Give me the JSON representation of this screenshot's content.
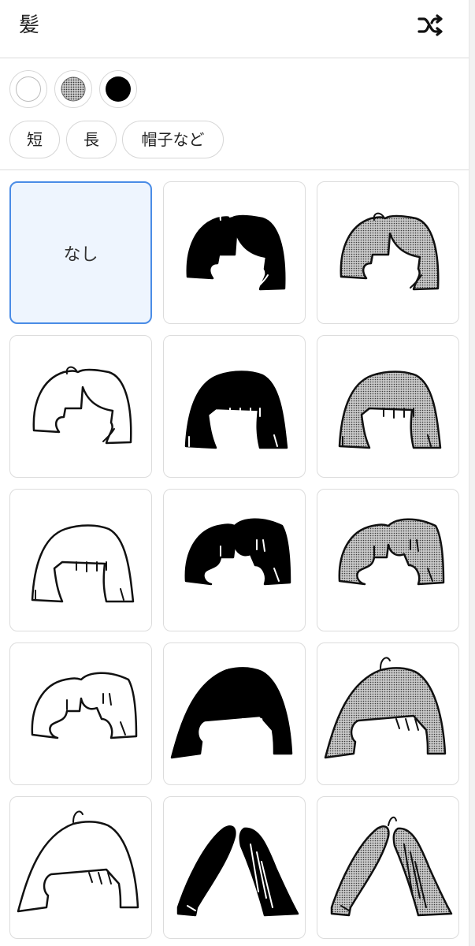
{
  "header": {
    "title": "髪",
    "shuffle_icon": "shuffle-icon"
  },
  "colors": [
    {
      "name": "white",
      "fill": "#ffffff"
    },
    {
      "name": "gray-screentone",
      "fill": "#8a8a8a"
    },
    {
      "name": "black",
      "fill": "#000000"
    }
  ],
  "categories": [
    {
      "label": "短"
    },
    {
      "label": "長"
    },
    {
      "label": "帽子など"
    }
  ],
  "grid": {
    "none_label": "なし",
    "selected_index": 0,
    "items": [
      {
        "kind": "none"
      },
      {
        "kind": "short-parted",
        "tone": "black"
      },
      {
        "kind": "short-parted",
        "tone": "gray"
      },
      {
        "kind": "short-parted",
        "tone": "white"
      },
      {
        "kind": "bob-bangs",
        "tone": "black"
      },
      {
        "kind": "bob-bangs",
        "tone": "gray"
      },
      {
        "kind": "bob-bangs",
        "tone": "white"
      },
      {
        "kind": "fluffy",
        "tone": "black"
      },
      {
        "kind": "fluffy",
        "tone": "gray"
      },
      {
        "kind": "fluffy",
        "tone": "white"
      },
      {
        "kind": "long-bob",
        "tone": "black"
      },
      {
        "kind": "long-bob",
        "tone": "gray"
      },
      {
        "kind": "long-bob",
        "tone": "white"
      },
      {
        "kind": "long-straight",
        "tone": "black"
      },
      {
        "kind": "long-straight",
        "tone": "gray"
      }
    ]
  },
  "palette": {
    "selected_border": "#4a8ce6",
    "selected_bg": "#eef5fe",
    "gray_tone": "#9a9a9a"
  }
}
